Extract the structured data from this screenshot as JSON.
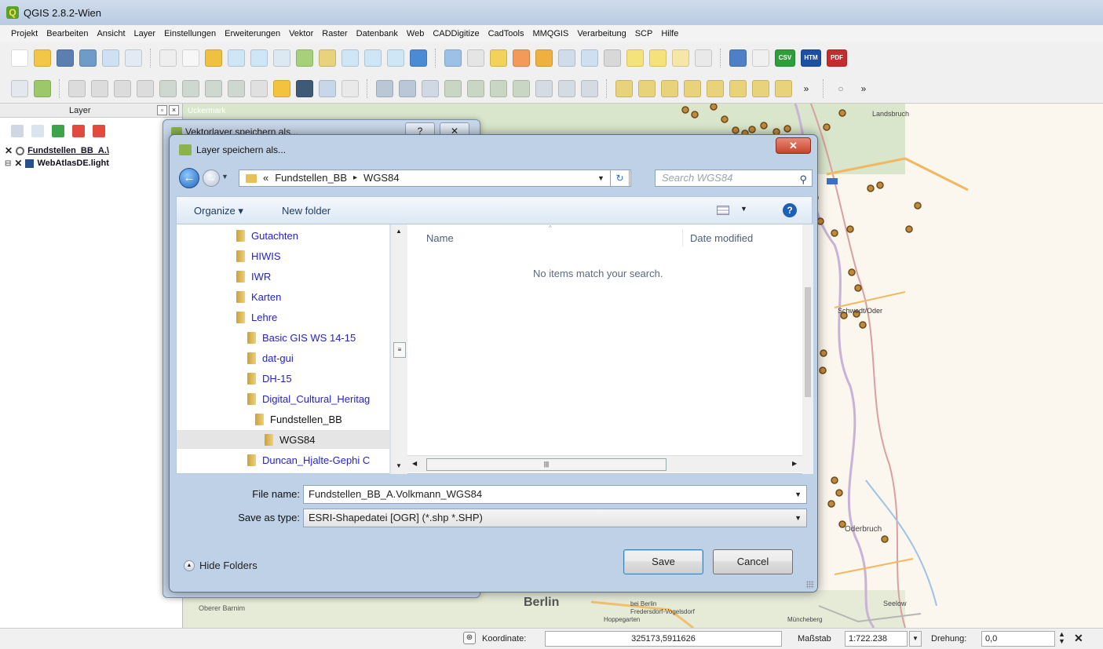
{
  "window": {
    "title": "QGIS 2.8.2-Wien"
  },
  "menu": [
    "Projekt",
    "Bearbeiten",
    "Ansicht",
    "Layer",
    "Einstellungen",
    "Erweiterungen",
    "Vektor",
    "Raster",
    "Datenbank",
    "Web",
    "CADDigitize",
    "CadTools",
    "MMQGIS",
    "Verarbeitung",
    "SCP",
    "Hilfe"
  ],
  "toolbar_badges": {
    "csv": "CSV",
    "htm": "HTM",
    "pdf": "PDF"
  },
  "layer_panel": {
    "title": "Layer",
    "layers": [
      {
        "name": "Fundstellen_BB_A.\\",
        "checked": "✕"
      },
      {
        "name": "WebAtlasDE.light",
        "checked": "✕"
      }
    ]
  },
  "map": {
    "labels": [
      "Berlin",
      "Schwedt/Oder",
      "Oderbruch",
      "Seelow",
      "Müncheberg",
      "Hoppegarten",
      "Fredersdorf-Vogelsdorf",
      "bei Berlin",
      "Oberer Barnim",
      "Landsbruch",
      "Uckermark"
    ]
  },
  "bg_dialog": {
    "title": "Vektorlayer speichern als...",
    "help": "?",
    "close": "✕"
  },
  "dialog": {
    "title": "Layer speichern als...",
    "close": "✕",
    "breadcrumb": {
      "prefix": "«",
      "parent": "Fundstellen_BB",
      "sep": "▸",
      "current": "WGS84"
    },
    "search_placeholder": "Search WGS84",
    "organize": "Organize ▾",
    "new_folder": "New folder",
    "help": "?",
    "tree": [
      {
        "label": "Gutachten",
        "level": 0
      },
      {
        "label": "HIWIS",
        "level": 0
      },
      {
        "label": "IWR",
        "level": 0
      },
      {
        "label": "Karten",
        "level": 0
      },
      {
        "label": "Lehre",
        "level": 0
      },
      {
        "label": "Basic GIS WS 14-15",
        "level": 1
      },
      {
        "label": "dat-gui",
        "level": 1
      },
      {
        "label": "DH-15",
        "level": 1
      },
      {
        "label": "Digital_Cultural_Heritag",
        "level": 1
      },
      {
        "label": "Fundstellen_BB",
        "level": 2
      },
      {
        "label": "WGS84",
        "level": 3,
        "selected": true
      },
      {
        "label": "Duncan_Hjalte-Gephi C",
        "level": 1
      }
    ],
    "columns": {
      "name": "Name",
      "date": "Date modified"
    },
    "empty_message": "No items match your search.",
    "file_name_label": "File name:",
    "file_name_value": "Fundstellen_BB_A.Volkmann_WGS84",
    "save_type_label": "Save as type:",
    "save_type_value": "ESRI-Shapedatei [OGR] (*.shp *.SHP)",
    "hide_folders": "Hide Folders",
    "save_button": "Save",
    "cancel_button": "Cancel"
  },
  "status": {
    "coord_label": "Koordinate:",
    "coord_value": "325173,5911626",
    "scale_label": "Maßstab",
    "scale_value": "1:722.238",
    "rotation_label": "Drehung:",
    "rotation_value": "0,0"
  }
}
